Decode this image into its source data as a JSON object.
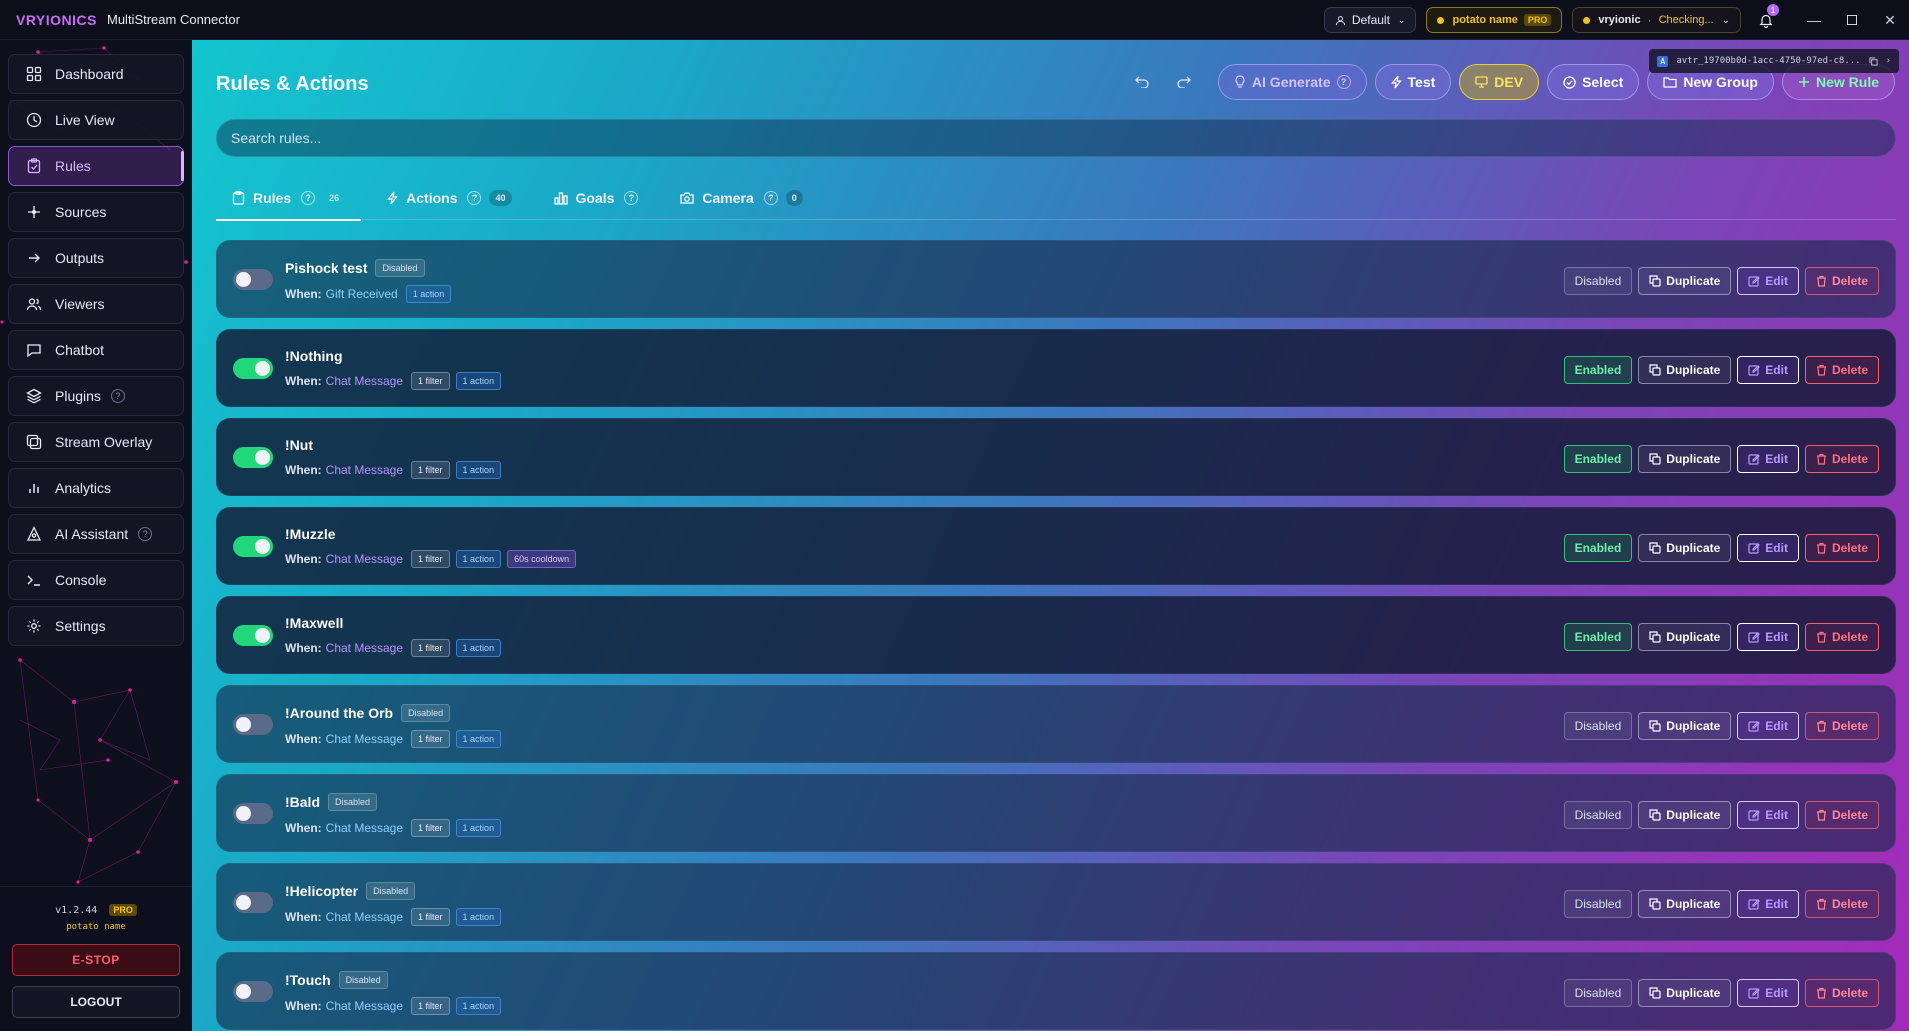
{
  "app": {
    "brand": "VRYIONICS",
    "title": "MultiStream Connector",
    "profile": "Default",
    "user_name": "potato name",
    "user_badge": "PRO",
    "vrc_name": "vryionic",
    "vrc_status": "Checking...",
    "notifications": "1"
  },
  "avatar_id": "avtr_19700b0d-1acc-4750-97ed-c8...",
  "sidebar": {
    "items": [
      {
        "label": "Dashboard",
        "icon": "grid-icon"
      },
      {
        "label": "Live View",
        "icon": "clock-icon"
      },
      {
        "label": "Rules",
        "icon": "clipboard-icon"
      },
      {
        "label": "Sources",
        "icon": "sparkle-icon"
      },
      {
        "label": "Outputs",
        "icon": "arrow-right-icon"
      },
      {
        "label": "Viewers",
        "icon": "users-icon"
      },
      {
        "label": "Chatbot",
        "icon": "chat-icon"
      },
      {
        "label": "Plugins",
        "icon": "layers-icon"
      },
      {
        "label": "Stream Overlay",
        "icon": "overlay-icon"
      },
      {
        "label": "Analytics",
        "icon": "bar-chart-icon"
      },
      {
        "label": "AI Assistant",
        "icon": "ai-icon"
      },
      {
        "label": "Console",
        "icon": "terminal-icon"
      },
      {
        "label": "Settings",
        "icon": "gear-icon"
      }
    ],
    "version": "v1.2.44",
    "version_badge": "PRO",
    "user": "potato name",
    "estop": "E-STOP",
    "logout": "LOGOUT"
  },
  "main": {
    "title": "Rules & Actions",
    "toolbar": {
      "ai_generate": "AI Generate",
      "test": "Test",
      "dev": "DEV",
      "select": "Select",
      "new_group": "New Group",
      "new_rule": "New Rule"
    },
    "search_placeholder": "Search rules...",
    "tabs": [
      {
        "label": "Rules",
        "count": "26"
      },
      {
        "label": "Actions",
        "count": "40"
      },
      {
        "label": "Goals",
        "count": ""
      },
      {
        "label": "Camera",
        "count": "0"
      }
    ],
    "when_label": "When:",
    "buttons": {
      "duplicate": "Duplicate",
      "edit": "Edit",
      "delete": "Delete"
    },
    "rules": [
      {
        "name": "Pishock test",
        "enabled": false,
        "badge": "Disabled",
        "trigger": "Gift Received",
        "filter": "",
        "action": "1 action",
        "extra": "",
        "state": "Disabled"
      },
      {
        "name": "!Nothing",
        "enabled": true,
        "badge": "",
        "trigger": "Chat Message",
        "filter": "1 filter",
        "action": "1 action",
        "extra": "",
        "state": "Enabled"
      },
      {
        "name": "!Nut",
        "enabled": true,
        "badge": "",
        "trigger": "Chat Message",
        "filter": "1 filter",
        "action": "1 action",
        "extra": "",
        "state": "Enabled"
      },
      {
        "name": "!Muzzle",
        "enabled": true,
        "badge": "",
        "trigger": "Chat Message",
        "filter": "1 filter",
        "action": "1 action",
        "extra": "60s cooldown",
        "state": "Enabled"
      },
      {
        "name": "!Maxwell",
        "enabled": true,
        "badge": "",
        "trigger": "Chat Message",
        "filter": "1 filter",
        "action": "1 action",
        "extra": "",
        "state": "Enabled"
      },
      {
        "name": "!Around the Orb",
        "enabled": false,
        "badge": "Disabled",
        "trigger": "Chat Message",
        "filter": "1 filter",
        "action": "1 action",
        "extra": "",
        "state": "Disabled"
      },
      {
        "name": "!Bald",
        "enabled": false,
        "badge": "Disabled",
        "trigger": "Chat Message",
        "filter": "1 filter",
        "action": "1 action",
        "extra": "",
        "state": "Disabled"
      },
      {
        "name": "!Helicopter",
        "enabled": false,
        "badge": "Disabled",
        "trigger": "Chat Message",
        "filter": "1 filter",
        "action": "1 action",
        "extra": "",
        "state": "Disabled"
      },
      {
        "name": "!Touch",
        "enabled": false,
        "badge": "Disabled",
        "trigger": "Chat Message",
        "filter": "1 filter",
        "action": "1 action",
        "extra": "",
        "state": "Disabled"
      }
    ]
  }
}
